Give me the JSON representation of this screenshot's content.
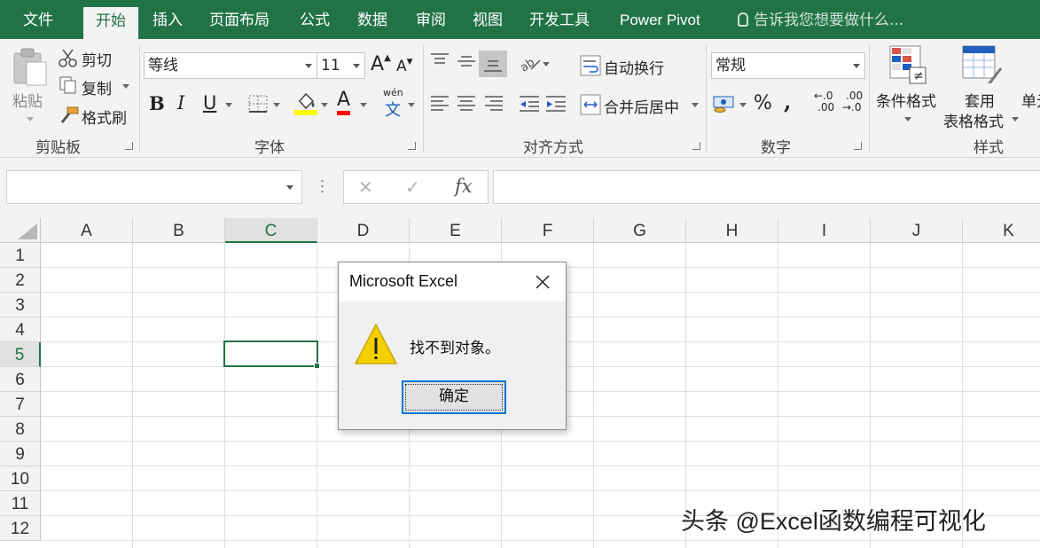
{
  "menu": {
    "tabs": [
      {
        "label": "文件"
      },
      {
        "label": "开始"
      },
      {
        "label": "插入"
      },
      {
        "label": "页面布局"
      },
      {
        "label": "公式"
      },
      {
        "label": "数据"
      },
      {
        "label": "审阅"
      },
      {
        "label": "视图"
      },
      {
        "label": "开发工具"
      },
      {
        "label": "Power Pivot"
      }
    ],
    "active_tab": "开始",
    "tell_me": "告诉我您想要做什么..."
  },
  "ribbon": {
    "clipboard": {
      "paste": "粘贴",
      "cut": "剪切",
      "copy": "复制",
      "format_painter": "格式刷",
      "group_label": "剪贴板"
    },
    "font": {
      "font_name": "等线",
      "font_size": "11",
      "grow_glyph": "A",
      "shrink_glyph": "A",
      "bold": "B",
      "italic": "I",
      "underline": "U",
      "font_color_glyph": "A",
      "phonetic_top": "wén",
      "phonetic_bottom": "文",
      "group_label": "字体"
    },
    "alignment": {
      "wrap_text": "自动换行",
      "merge_center": "合并后居中",
      "group_label": "对齐方式"
    },
    "number": {
      "format": "常规",
      "percent": "%",
      "comma": ",",
      "inc_decimal_top": "←.0",
      "inc_decimal_bottom": ".00",
      "dec_decimal_top": ".00",
      "dec_decimal_bottom": "→.0",
      "group_label": "数字"
    },
    "styles": {
      "conditional_formatting": "条件格式",
      "format_as_table_line1": "套用",
      "format_as_table_line2": "表格格式",
      "cell_styles_partial": "单元",
      "group_label": "样式"
    }
  },
  "formula_bar": {
    "name_box": "",
    "cancel_glyph": "✕",
    "enter_glyph": "✓",
    "fx_label": "fx",
    "formula": ""
  },
  "grid": {
    "columns": [
      "A",
      "B",
      "C",
      "D",
      "E",
      "F",
      "G",
      "H",
      "I",
      "J",
      "K"
    ],
    "rows": [
      "1",
      "2",
      "3",
      "4",
      "5",
      "6",
      "7",
      "8",
      "9",
      "10",
      "11",
      "12"
    ],
    "active_cell": "C5"
  },
  "dialog": {
    "title": "Microsoft Excel",
    "message": "找不到对象。",
    "ok_label": "确定"
  },
  "watermark": "头条 @Excel函数编程可视化",
  "colors": {
    "brand_green": "#217346",
    "ribbon_bg": "#f3f3f3",
    "warning_yellow": "#f5d000",
    "focus_blue": "#0078d7"
  }
}
